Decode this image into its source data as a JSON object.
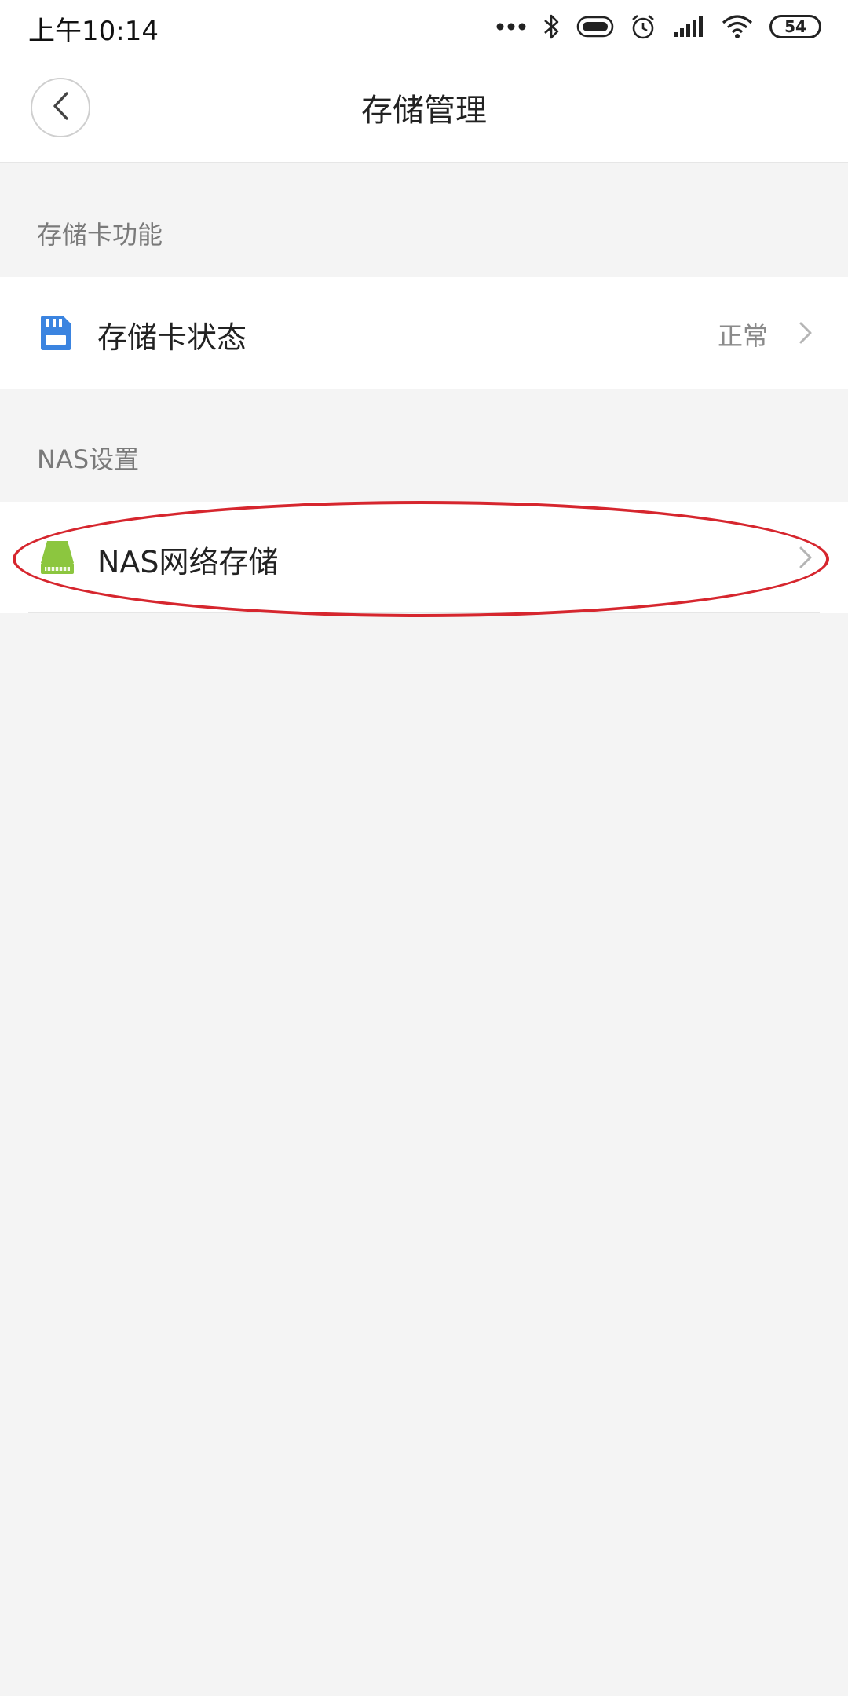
{
  "status_bar": {
    "time": "上午10:14",
    "battery": "54",
    "icons": [
      "more-dots-icon",
      "bluetooth-icon",
      "toggle-icon",
      "alarm-icon",
      "signal-icon",
      "wifi-icon",
      "battery-icon"
    ]
  },
  "header": {
    "title": "存储管理",
    "back_icon": "chevron-left-icon"
  },
  "sections": [
    {
      "label": "存储卡功能",
      "items": [
        {
          "label": "存储卡状态",
          "value": "正常",
          "icon": "sd-card-icon",
          "icon_color": "#3b84e0"
        }
      ]
    },
    {
      "label": "NAS设置",
      "items": [
        {
          "label": "NAS网络存储",
          "icon": "nas-drive-icon",
          "icon_color": "#8cc63f"
        }
      ]
    }
  ],
  "colors": {
    "background": "#f4f4f4",
    "annotation": "#d6262e"
  }
}
